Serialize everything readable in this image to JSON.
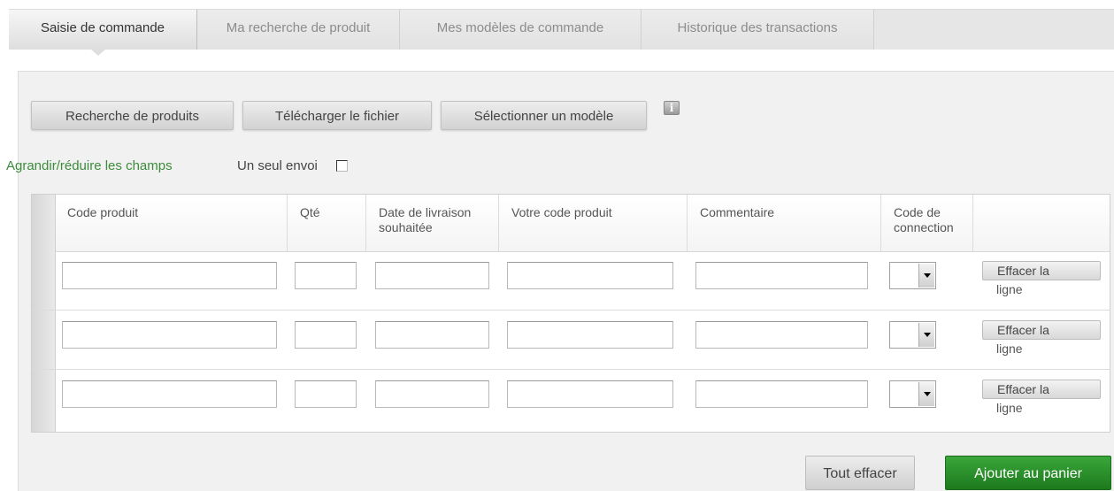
{
  "tabs": [
    {
      "label": "Saisie de commande",
      "active": true
    },
    {
      "label": "Ma recherche de produit",
      "active": false
    },
    {
      "label": "Mes modèles de commande",
      "active": false
    },
    {
      "label": "Historique des transactions",
      "active": false
    }
  ],
  "toolbar": {
    "product_search": "Recherche de produits",
    "upload_file": "Télécharger le fichier",
    "select_template": "Sélectionner un modèle",
    "info_icon": "i"
  },
  "options": {
    "toggle_fields": "Agrandir/réduire les champs",
    "single_shipment": "Un seul envoi"
  },
  "table": {
    "headers": {
      "product_code": "Code produit",
      "qty": "Qté",
      "delivery_date_line1": "Date de livraison",
      "delivery_date_line2": "souhaitée",
      "your_code": "Votre code produit",
      "comment": "Commentaire",
      "connection_line1": "Code de",
      "connection_line2": "connection"
    },
    "clear_line_1": "Effacer la",
    "clear_line_2": "ligne",
    "rows": [
      {
        "product_code": "",
        "qty": "",
        "delivery_date": "",
        "your_code": "",
        "comment": "",
        "connection": ""
      },
      {
        "product_code": "",
        "qty": "",
        "delivery_date": "",
        "your_code": "",
        "comment": "",
        "connection": ""
      },
      {
        "product_code": "",
        "qty": "",
        "delivery_date": "",
        "your_code": "",
        "comment": "",
        "connection": ""
      }
    ]
  },
  "footer": {
    "clear_all": "Tout effacer",
    "add_to_cart": "Ajouter au panier"
  },
  "colors": {
    "accent_green": "#2e8b2e",
    "link_green": "#3c8c3c"
  }
}
